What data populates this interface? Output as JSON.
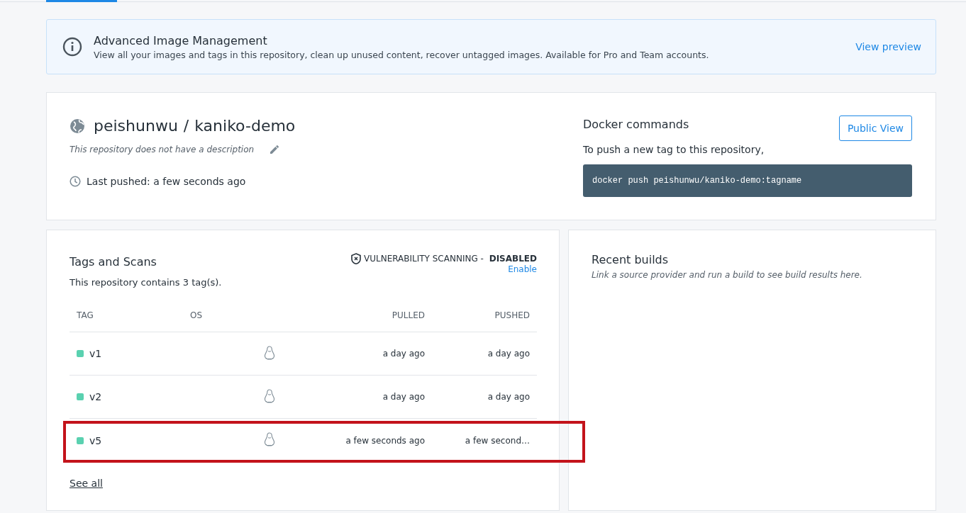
{
  "banner": {
    "title": "Advanced Image Management",
    "text": "View all your images and tags in this repository, clean up unused content, recover untagged images. Available for Pro and Team accounts.",
    "link": "View preview"
  },
  "repository": {
    "namespace": "peishunwu",
    "separator": "/",
    "name": "kaniko-demo",
    "description": "This repository does not have a description",
    "last_pushed": "Last pushed: a few seconds ago"
  },
  "docker_commands": {
    "title": "Docker commands",
    "button": "Public View",
    "text": "To push a new tag to this repository,",
    "command": "docker push peishunwu/kaniko-demo:tagname"
  },
  "tags": {
    "title": "Tags and Scans",
    "scanning_label": "VULNERABILITY SCANNING - ",
    "scanning_state": "DISABLED",
    "enable_link": "Enable",
    "count_text": "This repository contains 3 tag(s).",
    "columns": [
      "TAG",
      "OS",
      "PULLED",
      "PUSHED"
    ],
    "rows": [
      {
        "tag": "v1",
        "color": "#5ad1b0",
        "pulled": "a day ago",
        "pushed": "a day ago",
        "highlighted": false
      },
      {
        "tag": "v2",
        "color": "#5ad1b0",
        "pulled": "a day ago",
        "pushed": "a day ago",
        "highlighted": false
      },
      {
        "tag": "v5",
        "color": "#5ad1b0",
        "pulled": "a few seconds ago",
        "pushed": "a few second…",
        "highlighted": true
      }
    ],
    "see_all": "See all"
  },
  "recent_builds": {
    "title": "Recent builds",
    "text": "Link a source provider and run a build to see build results here."
  }
}
